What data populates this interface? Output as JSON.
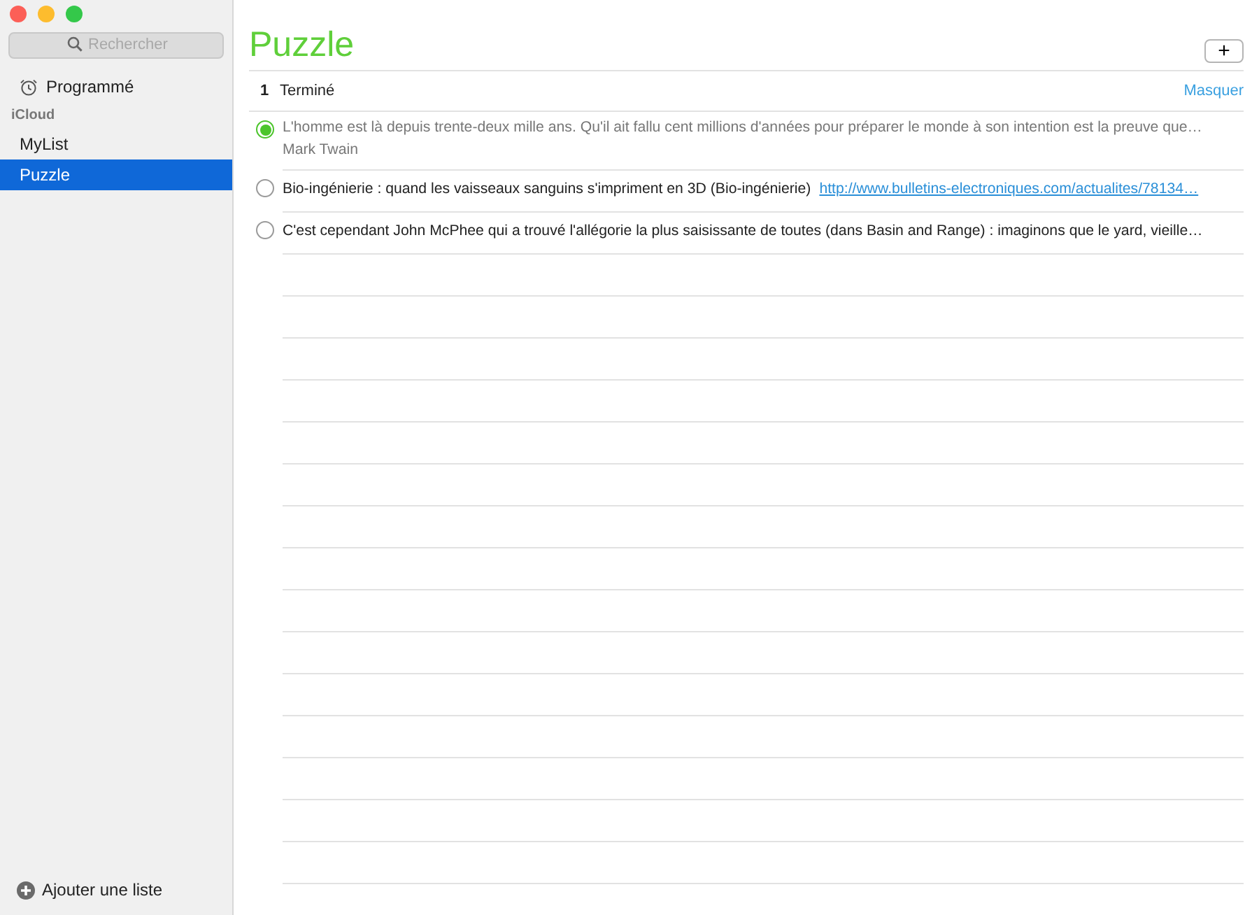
{
  "sidebar": {
    "search": {
      "placeholder": "Rechercher"
    },
    "smart_lists": [
      {
        "label": "Programmé",
        "selected": false
      }
    ],
    "section": "iCloud",
    "lists": [
      {
        "label": "MyList",
        "selected": false
      },
      {
        "label": "Puzzle",
        "selected": true
      }
    ],
    "add_list": "Ajouter une liste"
  },
  "main": {
    "title": "Puzzle",
    "add_button": "+",
    "completed_bar": {
      "count": "1",
      "label": "Terminé",
      "action": "Masquer"
    },
    "items": [
      {
        "text": "L'homme est là depuis trente-deux mille ans. Qu'il ait fallu cent millions d'années pour préparer le monde à son intention est la preuve que…",
        "note": "Mark Twain",
        "completed": true
      },
      {
        "text": "Bio-ingénierie : quand les vaisseaux sanguins s'impriment en 3D (Bio-ingénierie)",
        "link": "http://www.bulletins-electroniques.com/actualites/78134…",
        "completed": false
      },
      {
        "text": "C'est cependant John McPhee qui a trouvé l'allégorie la plus saisissante de toutes (dans Basin and Range) : imaginons que le yard, vieille…",
        "completed": false
      }
    ]
  }
}
